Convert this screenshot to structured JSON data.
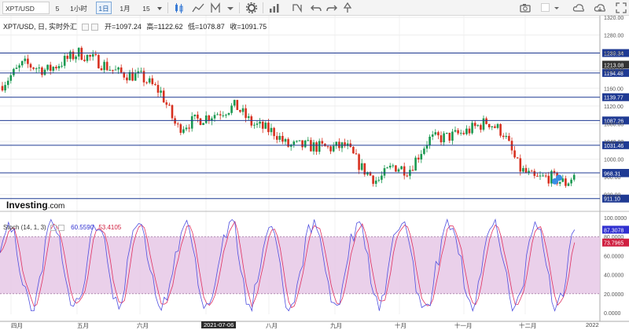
{
  "toolbar": {
    "symbol": "XPT/USD",
    "timeframes": [
      "5",
      "1小时",
      "1日",
      "1月",
      "15"
    ],
    "active_timeframe": "1日"
  },
  "legend": {
    "title": "XPT/USD, 日, 实时外汇",
    "open_label": "开=1097.24",
    "high_label": "高=1122.62",
    "low_label": "低=1078.87",
    "close_label": "收=1091.75"
  },
  "stoch": {
    "label": "Stoch (14, 1, 3)",
    "k_value": "60.5590",
    "d_value": "53.4105",
    "k_color": "#5050e0",
    "d_color": "#e03060"
  },
  "logo": {
    "text": "Investing",
    "suffix": ".com"
  },
  "colors": {
    "up": "#1a9850",
    "down": "#d7301f",
    "line": "#1f3a93",
    "band": "#e6c8e6"
  },
  "price_axis_ticks": [
    "1320.00",
    "1280.00",
    "1240.00",
    "1200.00",
    "1160.00",
    "1120.00",
    "1080.00",
    "1040.00",
    "1000.00",
    "960.00",
    "920.00"
  ],
  "price_levels": [
    "1239.34",
    "1194.48",
    "1139.77",
    "1087.26",
    "1031.46",
    "969.09",
    "911.10"
  ],
  "price_labels": {
    "last": "1213.08",
    "current": "968.31"
  },
  "stoch_axis_ticks": [
    "100.0000",
    "80.0000",
    "60.0000",
    "40.0000",
    "20.0000",
    "0.0000"
  ],
  "stoch_labels": {
    "k": "87.3078",
    "d": "73.7965"
  },
  "x_labels": [
    "四月",
    "五月",
    "六月",
    "2021-07-06",
    "八月",
    "九月",
    "十月",
    "十一月",
    "十二月",
    "2022"
  ]
}
